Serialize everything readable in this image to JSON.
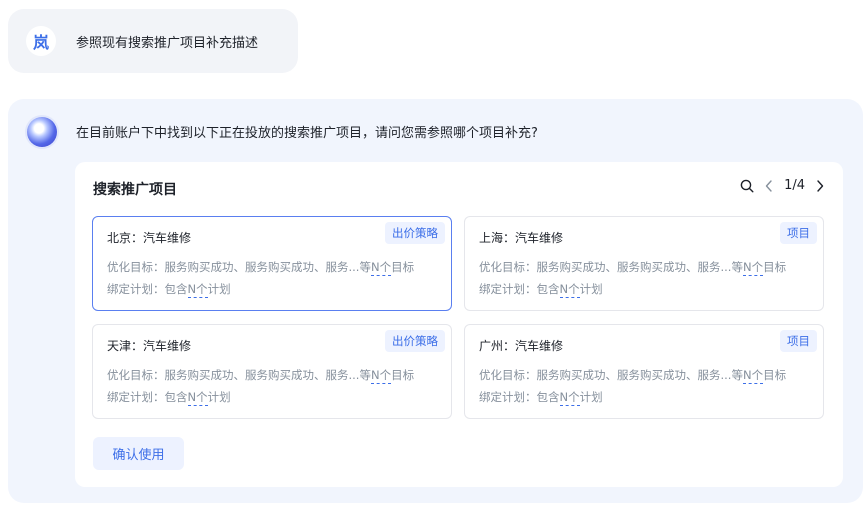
{
  "user": {
    "avatar_text": "岚",
    "message": "参照现有搜索推广项目补充描述"
  },
  "assistant": {
    "message": "在目前账户下中找到以下正在投放的搜索推广项目，请问您需参照哪个项目补充?"
  },
  "card": {
    "title": "搜索推广项目",
    "pagination": "1/4",
    "icons": {
      "search": "search-icon",
      "prev": "chevron-left-icon",
      "next": "chevron-right-icon"
    },
    "projects": [
      {
        "name": "北京：汽车维修",
        "tag": "出价策略",
        "goal_prefix": "优化目标：服务购买成功、服务购买成功、服务...等",
        "goal_link": "N个",
        "goal_suffix": "目标",
        "plan_prefix": "绑定计划：包含",
        "plan_link": "N个",
        "plan_suffix": "计划",
        "selected": true
      },
      {
        "name": "上海：汽车维修",
        "tag": "项目",
        "goal_prefix": "优化目标：服务购买成功、服务购买成功、服务...等",
        "goal_link": "N个",
        "goal_suffix": "目标",
        "plan_prefix": "绑定计划：包含",
        "plan_link": "N个",
        "plan_suffix": "计划",
        "selected": false
      },
      {
        "name": "天津：汽车维修",
        "tag": "出价策略",
        "goal_prefix": "优化目标：服务购买成功、服务购买成功、服务...等",
        "goal_link": "N个",
        "goal_suffix": "目标",
        "plan_prefix": "绑定计划：包含",
        "plan_link": "N个",
        "plan_suffix": "计划",
        "selected": false
      },
      {
        "name": "广州：汽车维修",
        "tag": "项目",
        "goal_prefix": "优化目标：服务购买成功、服务购买成功、服务...等",
        "goal_link": "N个",
        "goal_suffix": "目标",
        "plan_prefix": "绑定计划：包含",
        "plan_link": "N个",
        "plan_suffix": "计划",
        "selected": false
      }
    ],
    "confirm_label": "确认使用"
  },
  "colors": {
    "accent": "#3d6fe8",
    "selected_border": "#5a7ff0",
    "panel_bg": "#f1f5fd",
    "user_bubble_bg": "#f2f4f8",
    "tag_bg": "#edf2ff"
  }
}
